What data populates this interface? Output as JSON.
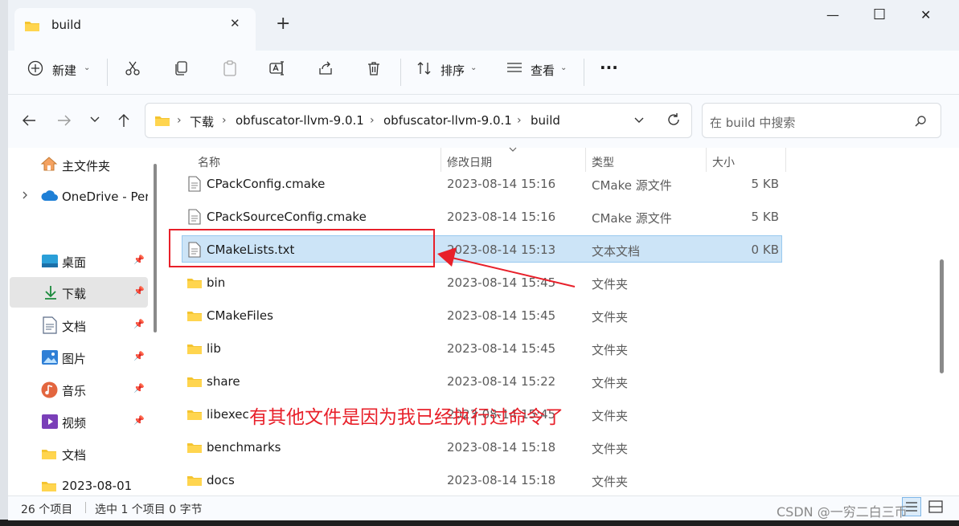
{
  "window": {
    "tab_title": "build",
    "tab_close": "✕",
    "new_tab": "+",
    "minimize": "—",
    "maximize": "☐",
    "close": "✕"
  },
  "toolbar": {
    "new_label": "新建",
    "sort_label": "排序",
    "view_label": "查看",
    "more_label": "···"
  },
  "address": {
    "crumbs": [
      "下载",
      "obfuscator-llvm-9.0.1",
      "obfuscator-llvm-9.0.1",
      "build"
    ],
    "search_placeholder": "在 build 中搜索"
  },
  "nav": {
    "items": [
      {
        "label": "主文件夹"
      },
      {
        "label": "OneDrive - Per"
      },
      {
        "label": "桌面"
      },
      {
        "label": "下载"
      },
      {
        "label": "文档"
      },
      {
        "label": "图片"
      },
      {
        "label": "音乐"
      },
      {
        "label": "视频"
      },
      {
        "label": "文档"
      },
      {
        "label": "2023-08-01"
      }
    ]
  },
  "columns": {
    "name": "名称",
    "date": "修改日期",
    "type": "类型",
    "size": "大小"
  },
  "files": [
    {
      "name": "CPackConfig.cmake",
      "date": "2023-08-14 15:16",
      "type": "CMake 源文件",
      "size": "5 KB",
      "kind": "doc"
    },
    {
      "name": "CPackSourceConfig.cmake",
      "date": "2023-08-14 15:16",
      "type": "CMake 源文件",
      "size": "5 KB",
      "kind": "doc"
    },
    {
      "name": "CMakeLists.txt",
      "date": "2023-08-14 15:13",
      "type": "文本文档",
      "size": "0 KB",
      "kind": "doc"
    },
    {
      "name": "bin",
      "date": "2023-08-14 15:45",
      "type": "文件夹",
      "size": "",
      "kind": "folder"
    },
    {
      "name": "CMakeFiles",
      "date": "2023-08-14 15:45",
      "type": "文件夹",
      "size": "",
      "kind": "folder"
    },
    {
      "name": "lib",
      "date": "2023-08-14 15:45",
      "type": "文件夹",
      "size": "",
      "kind": "folder"
    },
    {
      "name": "share",
      "date": "2023-08-14 15:22",
      "type": "文件夹",
      "size": "",
      "kind": "folder"
    },
    {
      "name": "libexec",
      "date": "2023-08-14 15:45",
      "type": "文件夹",
      "size": "",
      "kind": "folder"
    },
    {
      "name": "benchmarks",
      "date": "2023-08-14 15:18",
      "type": "文件夹",
      "size": "",
      "kind": "folder"
    },
    {
      "name": "docs",
      "date": "2023-08-14 15:18",
      "type": "文件夹",
      "size": "",
      "kind": "folder"
    }
  ],
  "status": {
    "count": "26 个项目",
    "selection": "选中 1 个项目 0 字节"
  },
  "annotation": {
    "text": "有其他文件是因为我已经执行过命令了",
    "color": "#e8202a"
  },
  "watermark": "CSDN @一穷二白三币",
  "colors": {
    "selection_bg": "#cce4f7",
    "folder": "#f4c430",
    "accent": "#0067c0"
  }
}
